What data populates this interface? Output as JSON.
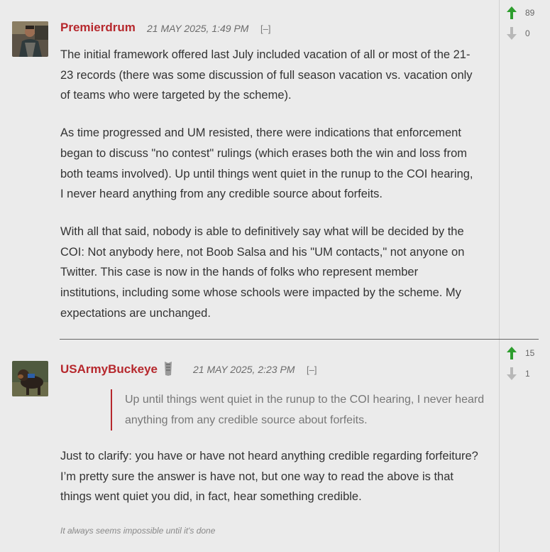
{
  "comments": [
    {
      "author": "Premierdrum",
      "timestamp": "21 MAY 2025, 1:49 PM",
      "collapse": "[–]",
      "upvotes": "89",
      "downvotes": "0",
      "paragraphs": [
        "The initial framework offered last July included vacation of all or most of the 21-23 records (there was some discussion of full season vacation vs. vacation only of teams who were targeted by the scheme).",
        "As time progressed and UM resisted, there were indications that enforcement began to discuss \"no contest\" rulings (which erases both the win and loss from both teams involved). Up until things went quiet in the runup to the COI hearing, I never heard anything from any credible source about forfeits.",
        "With all that said, nobody is able to definitively say what will be decided by the COI: Not anybody here, not Boob Salsa and his \"UM contacts,\" not anyone on Twitter. This case is now in the hands of folks who represent member institutions, including some whose schools were impacted by the scheme. My expectations are unchanged."
      ]
    },
    {
      "author": "USArmyBuckeye",
      "timestamp": "21 MAY 2025, 2:23 PM",
      "collapse": "[–]",
      "upvotes": "15",
      "downvotes": "1",
      "quote": " Up until things went quiet in the runup to the COI hearing, I never heard anything from any credible source about forfeits.",
      "paragraphs": [
        "Just to clarify: you have or have not heard anything credible regarding forfeiture?  I’m pretty sure the answer is have not, but one way to read the above is that things went quiet you did, in fact, hear something credible."
      ],
      "signature": "It always seems impossible until it's done"
    }
  ],
  "colors": {
    "author": "#b6282d",
    "upvote": "#2e9e2e",
    "downvote": "#b8b8b8"
  }
}
